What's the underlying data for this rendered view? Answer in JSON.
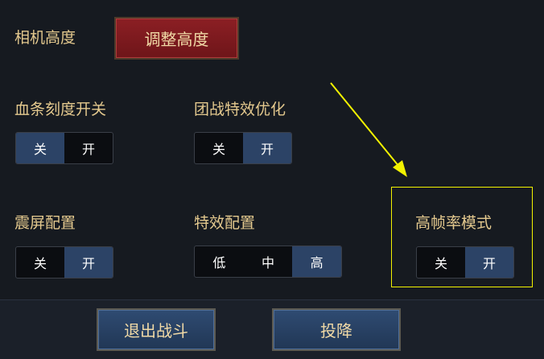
{
  "camera": {
    "label": "相机高度",
    "button": "调整高度"
  },
  "hp_scale": {
    "label": "血条刻度开关",
    "options": [
      "关",
      "开"
    ],
    "selected": "关"
  },
  "team_fx": {
    "label": "团战特效优化",
    "options": [
      "关",
      "开"
    ],
    "selected": "开"
  },
  "shake": {
    "label": "震屏配置",
    "options": [
      "关",
      "开"
    ],
    "selected": "开"
  },
  "effects": {
    "label": "特效配置",
    "options": [
      "低",
      "中",
      "高"
    ],
    "selected": "高"
  },
  "high_fps": {
    "label": "高帧率模式",
    "options": [
      "关",
      "开"
    ],
    "selected": "开"
  },
  "bottom": {
    "exit_button": "退出战斗",
    "surrender_button": "投降"
  },
  "colors": {
    "label": "#e4c98e",
    "active_segment": "#2c4366",
    "highlight": "#f2f200",
    "red_button": "#8c1f24"
  }
}
